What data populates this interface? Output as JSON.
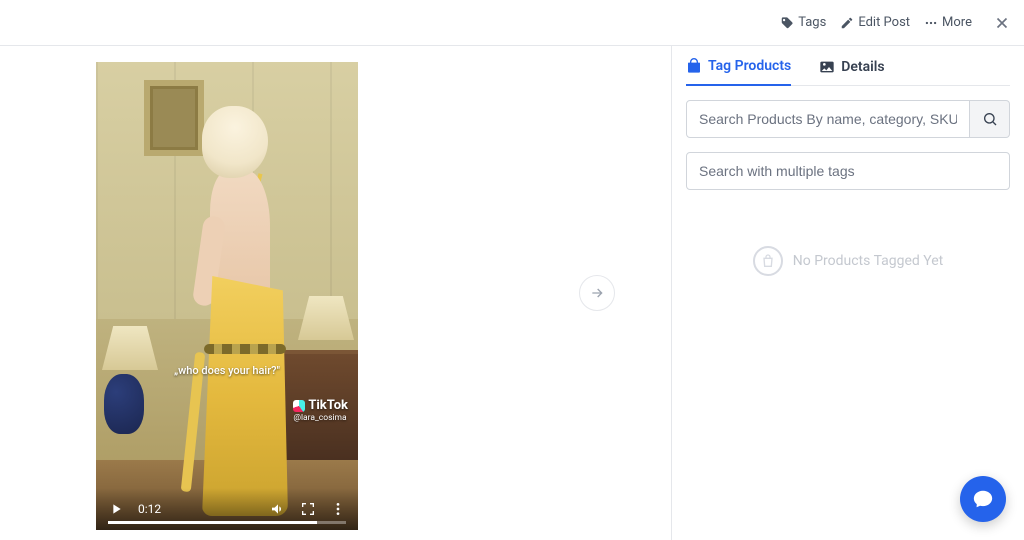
{
  "topbar": {
    "tags_label": "Tags",
    "edit_label": "Edit Post",
    "more_label": "More"
  },
  "media": {
    "caption_overlay": "„who does your hair?\"",
    "tiktok_brand": "TikTok",
    "tiktok_user": "@lara_cosima",
    "play_time": "0:12"
  },
  "tabs": {
    "tag_products": "Tag Products",
    "details": "Details"
  },
  "search": {
    "products_placeholder": "Search Products By name, category, SKU",
    "tags_placeholder": "Search with multiple tags"
  },
  "empty": {
    "message": "No Products Tagged Yet"
  }
}
